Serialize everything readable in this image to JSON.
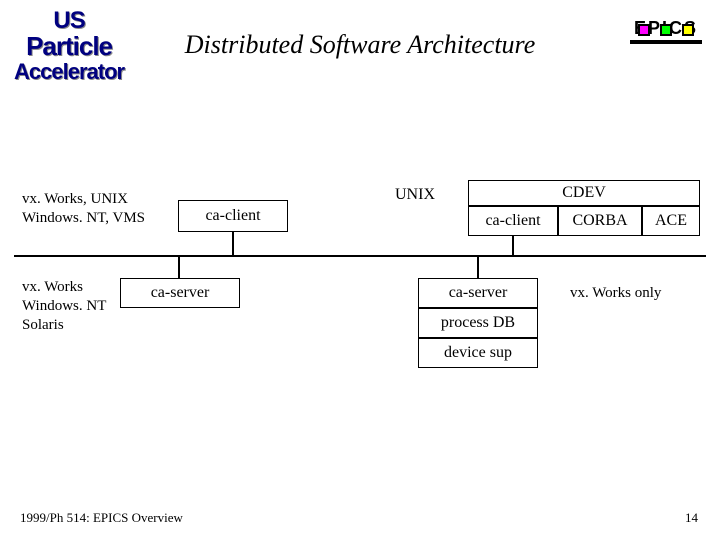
{
  "header": {
    "title": "Distributed Software Architecture",
    "epics": "EPICS",
    "org": {
      "l1": "US",
      "l2": "Particle",
      "l3": "Accelerator"
    }
  },
  "labels": {
    "platforms_client": "vx. Works, UNIX\nWindows. NT, VMS",
    "platforms_server": "vx. Works\nWindows. NT\nSolaris",
    "unix": "UNIX",
    "vxonly": "vx. Works only"
  },
  "boxes": {
    "ca_client_l": "ca-client",
    "cdev": "CDEV",
    "ca_client_r": "ca-client",
    "corba": "CORBA",
    "ace": "ACE",
    "ca_server_l": "ca-server",
    "ca_server_r": "ca-server",
    "process_db": "process DB",
    "device_sup": "device sup"
  },
  "footer": {
    "left": "1999/Ph 514: EPICS Overview",
    "page": "14"
  }
}
